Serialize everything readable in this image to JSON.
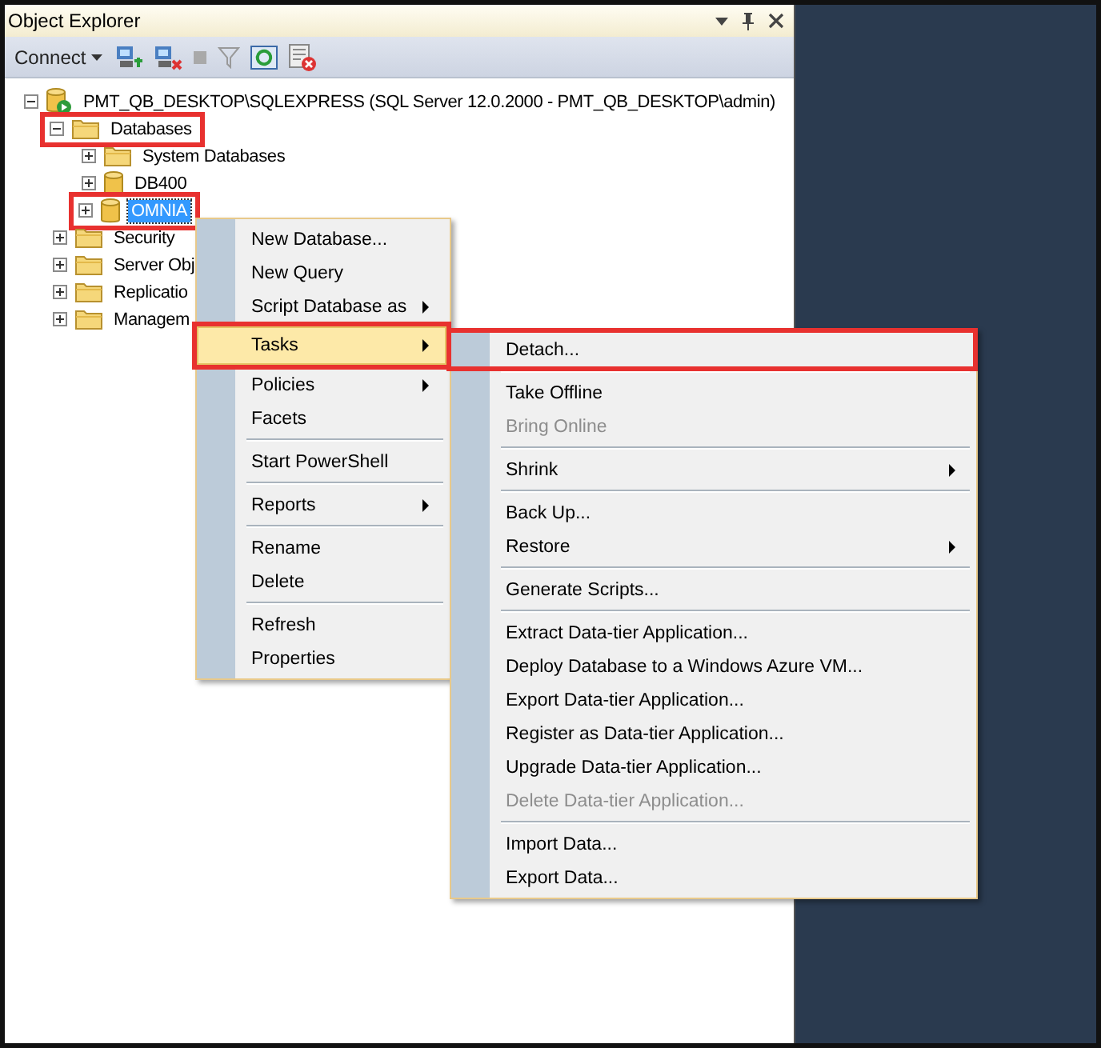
{
  "panel": {
    "title": "Object Explorer",
    "connect": "Connect"
  },
  "tree": [
    {
      "label": "PMT_QB_DESKTOP\\SQLEXPRESS (SQL Server 12.0.2000 - PMT_QB_DESKTOP\\admin)",
      "kind": "server",
      "expanded": true,
      "selected": false,
      "highlighted": false,
      "children": [
        {
          "label": "Databases",
          "kind": "folder",
          "expanded": true,
          "selected": false,
          "highlighted": true,
          "children": [
            {
              "label": "System Databases",
              "kind": "folder",
              "expanded": false,
              "selected": false,
              "highlighted": false
            },
            {
              "label": "DB400",
              "kind": "database",
              "expanded": false,
              "selected": false,
              "highlighted": false
            },
            {
              "label": "OMNIA",
              "kind": "database",
              "expanded": false,
              "selected": true,
              "highlighted": true
            }
          ]
        },
        {
          "label": "Security",
          "kind": "folder",
          "expanded": false,
          "selected": false,
          "highlighted": false
        },
        {
          "label": "Server Obj",
          "kind": "folder",
          "expanded": false,
          "selected": false,
          "highlighted": false
        },
        {
          "label": "Replicatio",
          "kind": "folder",
          "expanded": false,
          "selected": false,
          "highlighted": false
        },
        {
          "label": "Managem",
          "kind": "folder",
          "expanded": false,
          "selected": false,
          "highlighted": false
        }
      ]
    }
  ],
  "context_menu": {
    "items": [
      {
        "kind": "item",
        "label": "New Database...",
        "submenu": false,
        "selected": false,
        "disabled": false,
        "highlighted": false
      },
      {
        "kind": "item",
        "label": "New Query",
        "submenu": false,
        "selected": false,
        "disabled": false,
        "highlighted": false
      },
      {
        "kind": "item",
        "label": "Script Database as",
        "submenu": true,
        "selected": false,
        "disabled": false,
        "highlighted": false
      },
      {
        "kind": "item",
        "label": "Tasks",
        "submenu": true,
        "selected": true,
        "disabled": false,
        "highlighted": true
      },
      {
        "kind": "item",
        "label": "Policies",
        "submenu": true,
        "selected": false,
        "disabled": false,
        "highlighted": false
      },
      {
        "kind": "item",
        "label": "Facets",
        "submenu": false,
        "selected": false,
        "disabled": false,
        "highlighted": false
      },
      {
        "kind": "separator"
      },
      {
        "kind": "item",
        "label": "Start PowerShell",
        "submenu": false,
        "selected": false,
        "disabled": false,
        "highlighted": false
      },
      {
        "kind": "separator"
      },
      {
        "kind": "item",
        "label": "Reports",
        "submenu": true,
        "selected": false,
        "disabled": false,
        "highlighted": false
      },
      {
        "kind": "separator"
      },
      {
        "kind": "item",
        "label": "Rename",
        "submenu": false,
        "selected": false,
        "disabled": false,
        "highlighted": false
      },
      {
        "kind": "item",
        "label": "Delete",
        "submenu": false,
        "selected": false,
        "disabled": false,
        "highlighted": false
      },
      {
        "kind": "separator"
      },
      {
        "kind": "item",
        "label": "Refresh",
        "submenu": false,
        "selected": false,
        "disabled": false,
        "highlighted": false
      },
      {
        "kind": "item",
        "label": "Properties",
        "submenu": false,
        "selected": false,
        "disabled": false,
        "highlighted": false
      }
    ]
  },
  "tasks_submenu": {
    "items": [
      {
        "kind": "item",
        "label": "Detach...",
        "submenu": false,
        "selected": false,
        "disabled": false,
        "highlighted": true
      },
      {
        "kind": "separator"
      },
      {
        "kind": "item",
        "label": "Take Offline",
        "submenu": false,
        "selected": false,
        "disabled": false,
        "highlighted": false
      },
      {
        "kind": "item",
        "label": "Bring Online",
        "submenu": false,
        "selected": false,
        "disabled": true,
        "highlighted": false
      },
      {
        "kind": "separator"
      },
      {
        "kind": "item",
        "label": "Shrink",
        "submenu": true,
        "selected": false,
        "disabled": false,
        "highlighted": false
      },
      {
        "kind": "separator"
      },
      {
        "kind": "item",
        "label": "Back Up...",
        "submenu": false,
        "selected": false,
        "disabled": false,
        "highlighted": false
      },
      {
        "kind": "item",
        "label": "Restore",
        "submenu": true,
        "selected": false,
        "disabled": false,
        "highlighted": false
      },
      {
        "kind": "separator"
      },
      {
        "kind": "item",
        "label": "Generate Scripts...",
        "submenu": false,
        "selected": false,
        "disabled": false,
        "highlighted": false
      },
      {
        "kind": "separator"
      },
      {
        "kind": "item",
        "label": "Extract Data-tier Application...",
        "submenu": false,
        "selected": false,
        "disabled": false,
        "highlighted": false
      },
      {
        "kind": "item",
        "label": "Deploy Database to a Windows Azure VM...",
        "submenu": false,
        "selected": false,
        "disabled": false,
        "highlighted": false
      },
      {
        "kind": "item",
        "label": "Export Data-tier Application...",
        "submenu": false,
        "selected": false,
        "disabled": false,
        "highlighted": false
      },
      {
        "kind": "item",
        "label": "Register as Data-tier Application...",
        "submenu": false,
        "selected": false,
        "disabled": false,
        "highlighted": false
      },
      {
        "kind": "item",
        "label": "Upgrade Data-tier Application...",
        "submenu": false,
        "selected": false,
        "disabled": false,
        "highlighted": false
      },
      {
        "kind": "item",
        "label": "Delete Data-tier Application...",
        "submenu": false,
        "selected": false,
        "disabled": true,
        "highlighted": false
      },
      {
        "kind": "separator"
      },
      {
        "kind": "item",
        "label": "Import Data...",
        "submenu": false,
        "selected": false,
        "disabled": false,
        "highlighted": false
      },
      {
        "kind": "item",
        "label": "Export Data...",
        "submenu": false,
        "selected": false,
        "disabled": false,
        "highlighted": false
      }
    ]
  }
}
